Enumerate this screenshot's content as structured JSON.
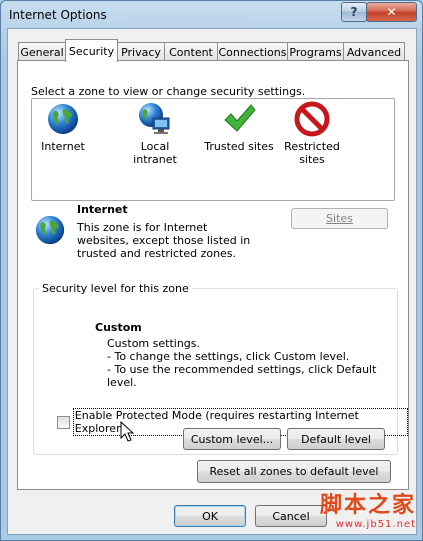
{
  "window": {
    "title": "Internet Options",
    "help_label": "?",
    "close_label": "✕"
  },
  "tabs": [
    {
      "label": "General"
    },
    {
      "label": "Security"
    },
    {
      "label": "Privacy"
    },
    {
      "label": "Content"
    },
    {
      "label": "Connections"
    },
    {
      "label": "Programs"
    },
    {
      "label": "Advanced"
    }
  ],
  "zones": {
    "prompt": "Select a zone to view or change security settings.",
    "items": [
      {
        "label": "Internet",
        "icon": "globe-icon"
      },
      {
        "label": "Local intranet",
        "icon": "intranet-icon"
      },
      {
        "label": "Trusted sites",
        "icon": "checkmark-icon"
      },
      {
        "label": "Restricted sites",
        "icon": "restricted-icon"
      }
    ],
    "selected": {
      "name": "Internet",
      "description": "This zone is for Internet websites, except those listed in trusted and restricted zones."
    },
    "sites_button": "Sites"
  },
  "security_level": {
    "group_title": "Security level for this zone",
    "level_title": "Custom",
    "lines": [
      "Custom settings.",
      "- To change the settings, click Custom level.",
      "- To use the recommended settings, click Default level."
    ],
    "protected_mode_label": "Enable Protected Mode (requires restarting Internet Explorer)",
    "protected_mode_checked": false,
    "custom_level_button": "Custom level...",
    "default_level_button": "Default level"
  },
  "reset_button": "Reset all zones to default level",
  "footer": {
    "ok": "OK",
    "cancel": "Cancel"
  },
  "watermark": {
    "text": "脚本之家",
    "url": "www.jb51.net"
  }
}
